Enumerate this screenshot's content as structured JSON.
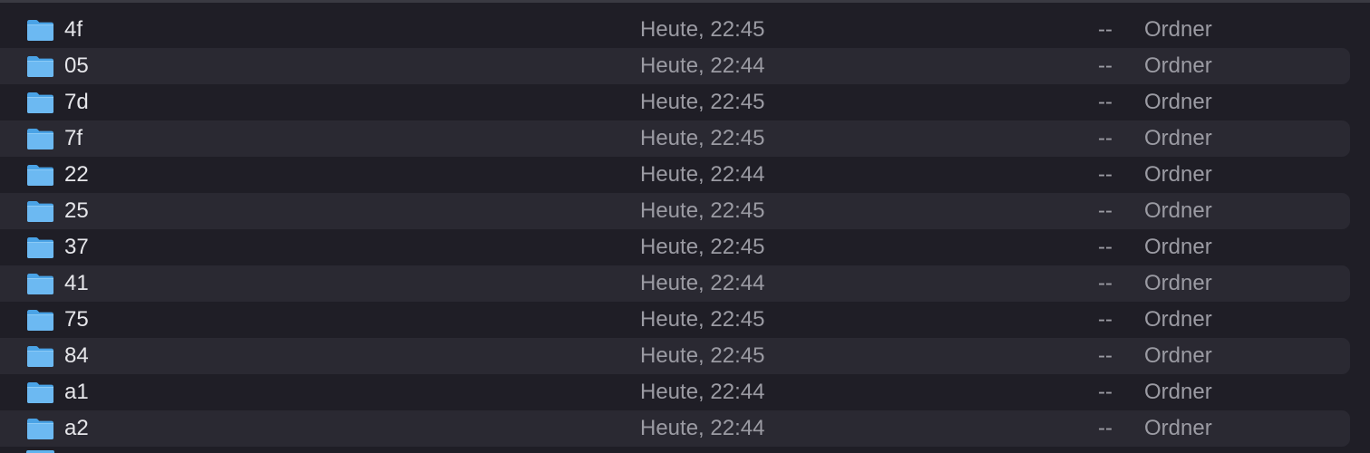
{
  "colors": {
    "background": "#1f1e26",
    "stripe": "#2a2932",
    "name_text": "#e6e6ea",
    "secondary_text": "#9b9ba3",
    "folder_blue": "#6cb9f2"
  },
  "items": [
    {
      "name": "4f",
      "date": "Heute, 22:45",
      "size": "--",
      "kind": "Ordner",
      "icon": "folder-icon"
    },
    {
      "name": "05",
      "date": "Heute, 22:44",
      "size": "--",
      "kind": "Ordner",
      "icon": "folder-icon"
    },
    {
      "name": "7d",
      "date": "Heute, 22:45",
      "size": "--",
      "kind": "Ordner",
      "icon": "folder-icon"
    },
    {
      "name": "7f",
      "date": "Heute, 22:45",
      "size": "--",
      "kind": "Ordner",
      "icon": "folder-icon"
    },
    {
      "name": "22",
      "date": "Heute, 22:44",
      "size": "--",
      "kind": "Ordner",
      "icon": "folder-icon"
    },
    {
      "name": "25",
      "date": "Heute, 22:45",
      "size": "--",
      "kind": "Ordner",
      "icon": "folder-icon"
    },
    {
      "name": "37",
      "date": "Heute, 22:45",
      "size": "--",
      "kind": "Ordner",
      "icon": "folder-icon"
    },
    {
      "name": "41",
      "date": "Heute, 22:44",
      "size": "--",
      "kind": "Ordner",
      "icon": "folder-icon"
    },
    {
      "name": "75",
      "date": "Heute, 22:45",
      "size": "--",
      "kind": "Ordner",
      "icon": "folder-icon"
    },
    {
      "name": "84",
      "date": "Heute, 22:45",
      "size": "--",
      "kind": "Ordner",
      "icon": "folder-icon"
    },
    {
      "name": "a1",
      "date": "Heute, 22:44",
      "size": "--",
      "kind": "Ordner",
      "icon": "folder-icon"
    },
    {
      "name": "a2",
      "date": "Heute, 22:44",
      "size": "--",
      "kind": "Ordner",
      "icon": "folder-icon"
    }
  ]
}
